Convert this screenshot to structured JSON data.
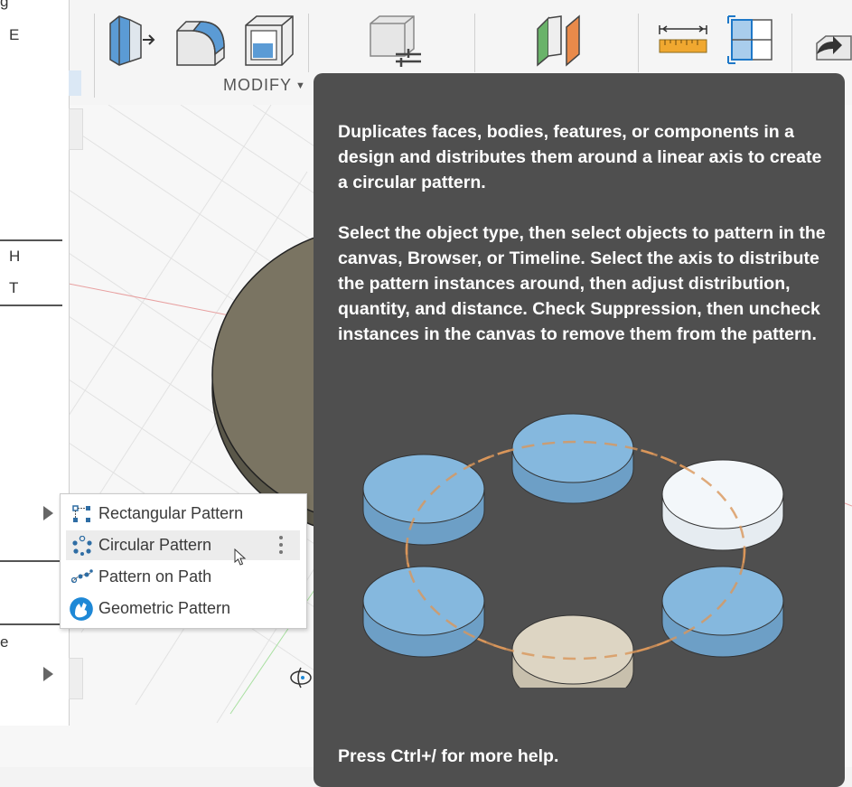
{
  "toolbar": {
    "modify_label": "MODIFY",
    "modify_caret": "▼"
  },
  "left_panel": {
    "items": [
      {
        "text": "g"
      },
      {
        "text": "E"
      },
      {
        "text": "H"
      },
      {
        "text": "T"
      },
      {
        "text": "e"
      }
    ]
  },
  "pattern_menu": {
    "items": [
      {
        "label": "Rectangular Pattern",
        "icon": "rectangular-pattern-icon"
      },
      {
        "label": "Circular Pattern",
        "icon": "circular-pattern-icon",
        "hovered": true
      },
      {
        "label": "Pattern on Path",
        "icon": "pattern-on-path-icon"
      },
      {
        "label": "Geometric Pattern",
        "icon": "geometric-pattern-icon"
      }
    ]
  },
  "tooltip": {
    "description": "Duplicates faces, bodies, features, or components in a design and distributes them around a linear axis to create a circular pattern.",
    "instructions": "Select the object type, then select objects to pattern in the canvas, Browser, or Timeline. Select the axis to distribute the pattern instances around, then adjust distribution, quantity, and distance. Check Suppression, then uncheck instances in the canvas to remove them from the pattern.",
    "footer": "Press Ctrl+/ for more help."
  },
  "colors": {
    "tooltip_bg": "#4f4f4f",
    "disk_blue": "#7fb4da",
    "disk_beige": "#ddd5c3",
    "disk_white": "#f2f6f9",
    "path_orange": "#d9965a",
    "model_body": "#6e6a5a"
  }
}
